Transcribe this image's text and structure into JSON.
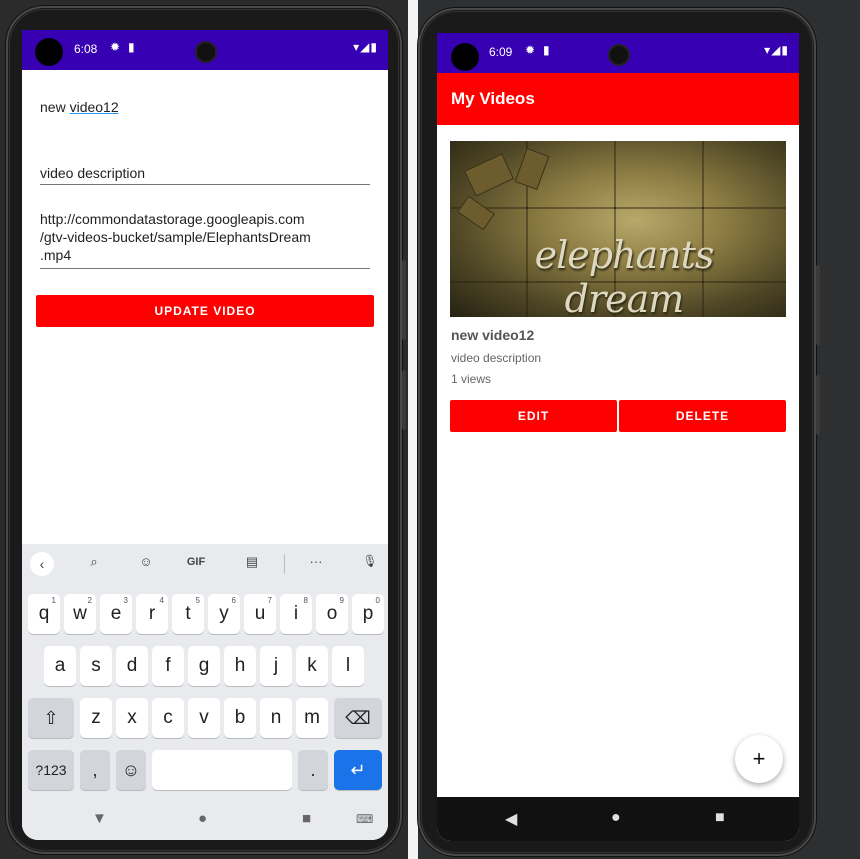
{
  "left_screen": {
    "status_bar": {
      "time": "6:08"
    },
    "form": {
      "title_value_plain": "new ",
      "title_value_underlined": "video12",
      "description_value": "video description",
      "url_line1": "http://commondatastorage.googleapis.com",
      "url_line2": "/gtv-videos-bucket/sample/ElephantsDream",
      "url_line3": ".mp4",
      "update_button": "UPDATE VIDEO"
    },
    "keyboard": {
      "toolbar": {
        "back": "‹",
        "search": "⌕",
        "sticker": "☺",
        "gif": "GIF",
        "clipboard": "▤",
        "more": "···",
        "mic": "🎙"
      },
      "row1": [
        {
          "k": "q",
          "n": "1"
        },
        {
          "k": "w",
          "n": "2"
        },
        {
          "k": "e",
          "n": "3"
        },
        {
          "k": "r",
          "n": "4"
        },
        {
          "k": "t",
          "n": "5"
        },
        {
          "k": "y",
          "n": "6"
        },
        {
          "k": "u",
          "n": "7"
        },
        {
          "k": "i",
          "n": "8"
        },
        {
          "k": "o",
          "n": "9"
        },
        {
          "k": "p",
          "n": "0"
        }
      ],
      "row2": [
        "a",
        "s",
        "d",
        "f",
        "g",
        "h",
        "j",
        "k",
        "l"
      ],
      "row3": [
        "z",
        "x",
        "c",
        "v",
        "b",
        "n",
        "m"
      ],
      "shift": "⇧",
      "backspace": "⌫",
      "symbols": "?123",
      "comma": ",",
      "emoji": "☺",
      "period": ".",
      "enter": "↵"
    },
    "nav": {
      "back": "▼",
      "home": "●",
      "recents": "■",
      "keyboard_switch": "⌨"
    }
  },
  "right_screen": {
    "status_bar": {
      "time": "6:09"
    },
    "appbar": {
      "title": "My Videos"
    },
    "video": {
      "thumbnail_text": "elephants dream",
      "title": "new video12",
      "description": "video description",
      "views": "1 views",
      "edit_button": "EDIT",
      "delete_button": "DELETE"
    },
    "fab": {
      "label": "+"
    },
    "nav": {
      "back": "◀",
      "home": "●",
      "recents": "■"
    }
  },
  "colors": {
    "accent": "#ff0000",
    "status_bar": "#3700b3",
    "keyboard_enter": "#1a73e8"
  }
}
